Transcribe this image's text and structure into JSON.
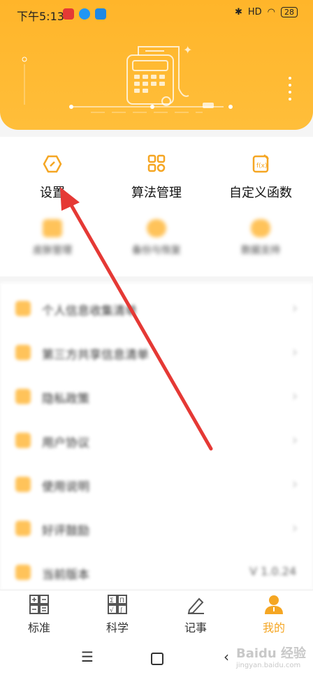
{
  "status_bar": {
    "time": "下午5:13",
    "signal": "HD",
    "battery": "28"
  },
  "grid_top": [
    {
      "label": "设置",
      "icon": "settings-hexagon-icon"
    },
    {
      "label": "算法管理",
      "icon": "algorithm-grid-icon"
    },
    {
      "label": "自定义函数",
      "icon": "custom-function-icon"
    }
  ],
  "grid_bottom_blurred": [
    {
      "label": "皮肤管理"
    },
    {
      "label": "备份与恢复"
    },
    {
      "label": "数据支持"
    }
  ],
  "list_blurred": [
    {
      "label": "个人信息收集清单"
    },
    {
      "label": "第三方共享信息清单"
    },
    {
      "label": "隐私政策"
    },
    {
      "label": "用户协议"
    },
    {
      "label": "使用说明"
    },
    {
      "label": "好评鼓励"
    },
    {
      "label": "当前版本",
      "value": "V 1.0.24"
    }
  ],
  "tabs": [
    {
      "label": "标准",
      "icon": "standard-calculator-icon"
    },
    {
      "label": "科学",
      "icon": "scientific-calculator-icon"
    },
    {
      "label": "记事",
      "icon": "pencil-note-icon"
    },
    {
      "label": "我的",
      "icon": "user-profile-icon",
      "active": true
    }
  ],
  "colors": {
    "accent": "#ffb52a",
    "arrow": "#e53935",
    "active_tab": "#f5a623"
  },
  "watermark": {
    "brand": "Baidu 经验",
    "url": "jingyan.baidu.com"
  }
}
